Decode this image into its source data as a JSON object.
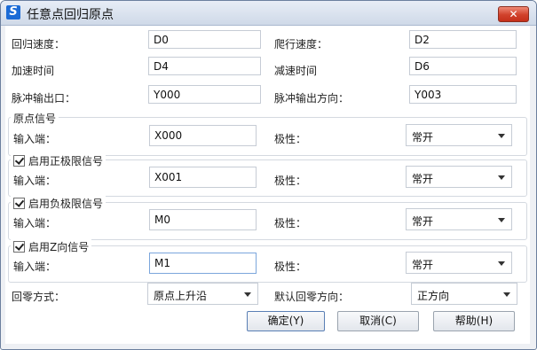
{
  "window": {
    "title": "任意点回归原点",
    "close_label": "✕",
    "app_icon": "S"
  },
  "fields": {
    "return_speed": {
      "label": "回归速度：",
      "value": "D0"
    },
    "crawl_speed": {
      "label": "爬行速度：",
      "value": "D2"
    },
    "accel_time": {
      "label": "加速时间",
      "value": "D4"
    },
    "decel_time": {
      "label": "减速时间",
      "value": "D6"
    },
    "pulse_output": {
      "label": "脉冲输出口：",
      "value": "Y000"
    },
    "pulse_dir": {
      "label": "脉冲输出方向：",
      "value": "Y003"
    }
  },
  "groups": {
    "origin": {
      "title": "原点信号",
      "checked": false,
      "input_label": "输入端：",
      "input_value": "X000",
      "polarity_label": "极性：",
      "polarity_value": "常开"
    },
    "pos_limit": {
      "title": "启用正极限信号",
      "checked": true,
      "input_label": "输入端：",
      "input_value": "X001",
      "polarity_label": "极性：",
      "polarity_value": "常开"
    },
    "neg_limit": {
      "title": "启用负极限信号",
      "checked": true,
      "input_label": "输入端：",
      "input_value": "M0",
      "polarity_label": "极性：",
      "polarity_value": "常开"
    },
    "z_signal": {
      "title": "启用Z向信号",
      "checked": true,
      "input_label": "输入端：",
      "input_value": "M1",
      "polarity_label": "极性：",
      "polarity_value": "常开"
    }
  },
  "return_mode": {
    "label": "回零方式：",
    "value": "原点上升沿"
  },
  "return_direction": {
    "label": "默认回零方向：",
    "value": "正方向"
  },
  "buttons": {
    "ok": "确定(Y)",
    "cancel": "取消(C)",
    "help": "帮助(H)"
  }
}
